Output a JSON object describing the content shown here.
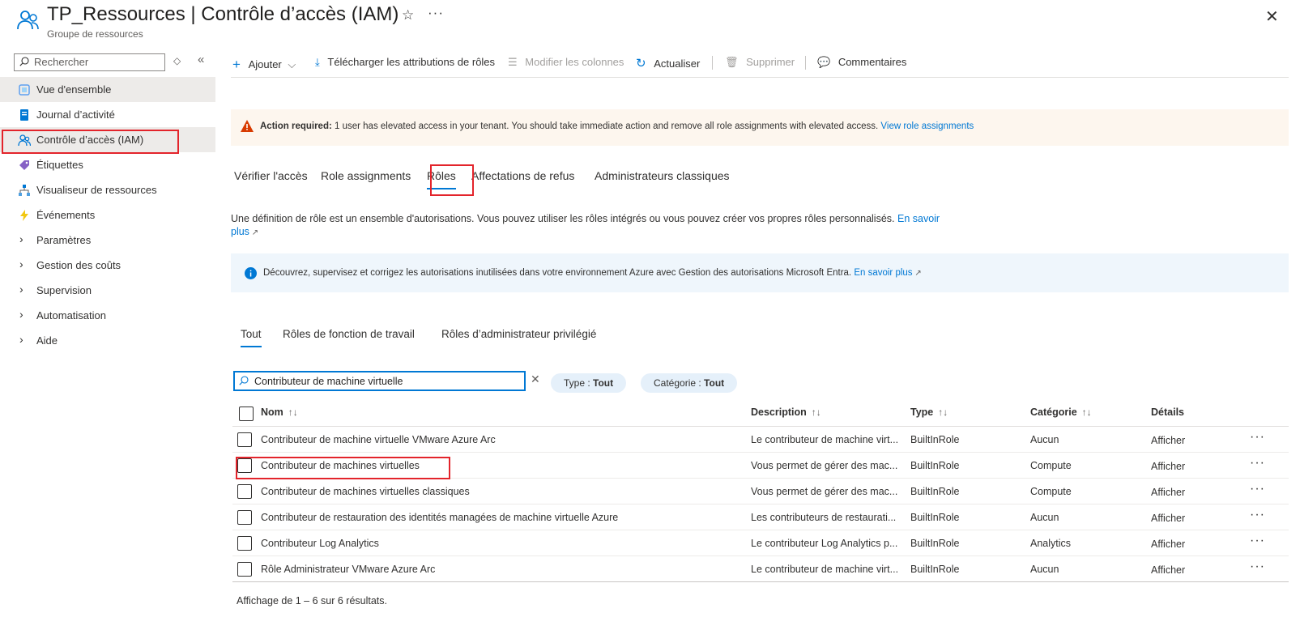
{
  "header": {
    "title": "TP_Ressources | Contrôle d’accès (IAM)",
    "subtitle": "Groupe de ressources",
    "star_icon": "star-icon",
    "more_label": "···",
    "close_label": "✕"
  },
  "sidebar": {
    "search_placeholder": "Rechercher",
    "items": [
      {
        "label": "Vue d'ensemble",
        "icon": "overview-icon",
        "color": "#5ea0ef"
      },
      {
        "label": "Journal d’activité",
        "icon": "log-icon",
        "color": "#0078d4"
      },
      {
        "label": "Contrôle d’accès (IAM)",
        "icon": "people-icon",
        "color": "#0078d4"
      },
      {
        "label": "Étiquettes",
        "icon": "tag-icon",
        "color": "#8661c5"
      },
      {
        "label": "Visualiseur de ressources",
        "icon": "hierarchy-icon",
        "color": "#0078d4"
      },
      {
        "label": "Événements",
        "icon": "lightning-icon",
        "color": "#f2c811"
      },
      {
        "label": "Paramètres"
      },
      {
        "label": "Gestion des coûts"
      },
      {
        "label": "Supervision"
      },
      {
        "label": "Automatisation"
      },
      {
        "label": "Aide"
      }
    ]
  },
  "toolbar": {
    "add": "Ajouter",
    "download": "Télécharger les attributions de rôles",
    "edit_columns": "Modifier les colonnes",
    "refresh": "Actualiser",
    "delete": "Supprimer",
    "feedback": "Commentaires"
  },
  "alert": {
    "bold": "Action required:",
    "text": " 1 user has elevated access in your tenant. You should take immediate action and remove all role assignments with elevated access. ",
    "link": "View role assignments"
  },
  "tabs": [
    "Vérifier l'accès",
    "Role assignments",
    "Rôles",
    "Affectations de refus",
    "Administrateurs classiques"
  ],
  "description": {
    "text": "Une définition de rôle est un ensemble d'autorisations. Vous pouvez utiliser les rôles intégrés ou vous pouvez créer vos propres rôles personnalisés. ",
    "link_a": "En savoir",
    "link_b": "plus"
  },
  "info": {
    "text": "Découvrez, supervisez et corrigez les autorisations inutilisées dans votre environnement Azure avec Gestion des autorisations Microsoft Entra. ",
    "link": "En savoir plus"
  },
  "subtabs": [
    "Tout",
    "Rôles de fonction de travail",
    "Rôles d’administrateur privilégié"
  ],
  "filter": {
    "value": "Contributeur de machine virtuelle",
    "type_label": "Type : ",
    "type_value": "Tout",
    "category_label": "Catégorie : ",
    "category_value": "Tout"
  },
  "table": {
    "headers": {
      "name": "Nom",
      "description": "Description",
      "type": "Type",
      "category": "Catégorie",
      "details": "Détails"
    },
    "rows": [
      {
        "name": "Contributeur de machine virtuelle VMware Azure Arc",
        "description": "Le contributeur de machine virt...",
        "type": "BuiltInRole",
        "category": "Aucun",
        "details": "Afficher"
      },
      {
        "name": "Contributeur de machines virtuelles",
        "description": "Vous permet de gérer des mac...",
        "type": "BuiltInRole",
        "category": "Compute",
        "details": "Afficher"
      },
      {
        "name": "Contributeur de machines virtuelles classiques",
        "description": "Vous permet de gérer des mac...",
        "type": "BuiltInRole",
        "category": "Compute",
        "details": "Afficher"
      },
      {
        "name": "Contributeur de restauration des identités managées de machine virtuelle Azure",
        "description": "Les contributeurs de restaurati...",
        "type": "BuiltInRole",
        "category": "Aucun",
        "details": "Afficher"
      },
      {
        "name": "Contributeur Log Analytics",
        "description": "Le contributeur Log Analytics p...",
        "type": "BuiltInRole",
        "category": "Analytics",
        "details": "Afficher"
      },
      {
        "name": "Rôle Administrateur VMware Azure Arc",
        "description": "Le contributeur de machine virt...",
        "type": "BuiltInRole",
        "category": "Aucun",
        "details": "Afficher"
      }
    ],
    "footer": "Affichage de 1 – 6 sur 6 résultats."
  },
  "colors": {
    "accent": "#0078d4",
    "highlight": "#e3242b",
    "warning": "#d83b01"
  }
}
